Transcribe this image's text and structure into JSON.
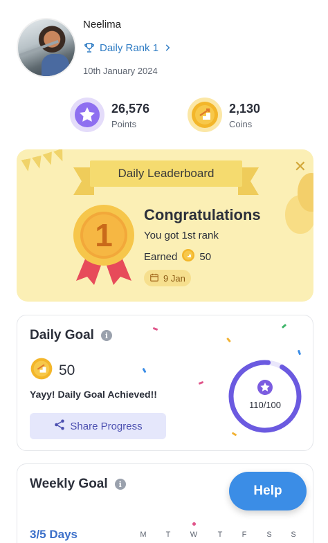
{
  "profile": {
    "name": "Neelima",
    "rank_label": "Daily Rank 1",
    "date": "10th January 2024",
    "icons": {
      "rank": "trophy-icon",
      "chevron": "chevron-right-icon"
    }
  },
  "stats": {
    "points": {
      "value": "26,576",
      "label": "Points",
      "icon": "star-icon",
      "color": "#7b5ce0"
    },
    "coins": {
      "value": "2,130",
      "label": "Coins",
      "icon": "coin-stairs-icon",
      "color": "#f3b62a"
    }
  },
  "leaderboard": {
    "title": "Daily Leaderboard",
    "heading": "Congratulations",
    "subtitle": "You got 1st rank",
    "earned_label": "Earned",
    "earned_value": "50",
    "date_chip": "9 Jan",
    "medal_number": "1",
    "background": "#fbefb5"
  },
  "daily_goal": {
    "title": "Daily Goal",
    "coins": "50",
    "message": "Yayy! Daily Goal Achieved!!",
    "share_label": "Share Progress",
    "progress_text": "110/100",
    "progress_fraction": 1.0,
    "ring_color": "#6b5ae0"
  },
  "weekly_goal": {
    "title": "Weekly Goal",
    "days_text": "3/5 Days",
    "weekdays": [
      "M",
      "T",
      "W",
      "T",
      "F",
      "S",
      "S"
    ]
  },
  "help": {
    "label": "Help",
    "color": "#3b8de6"
  }
}
